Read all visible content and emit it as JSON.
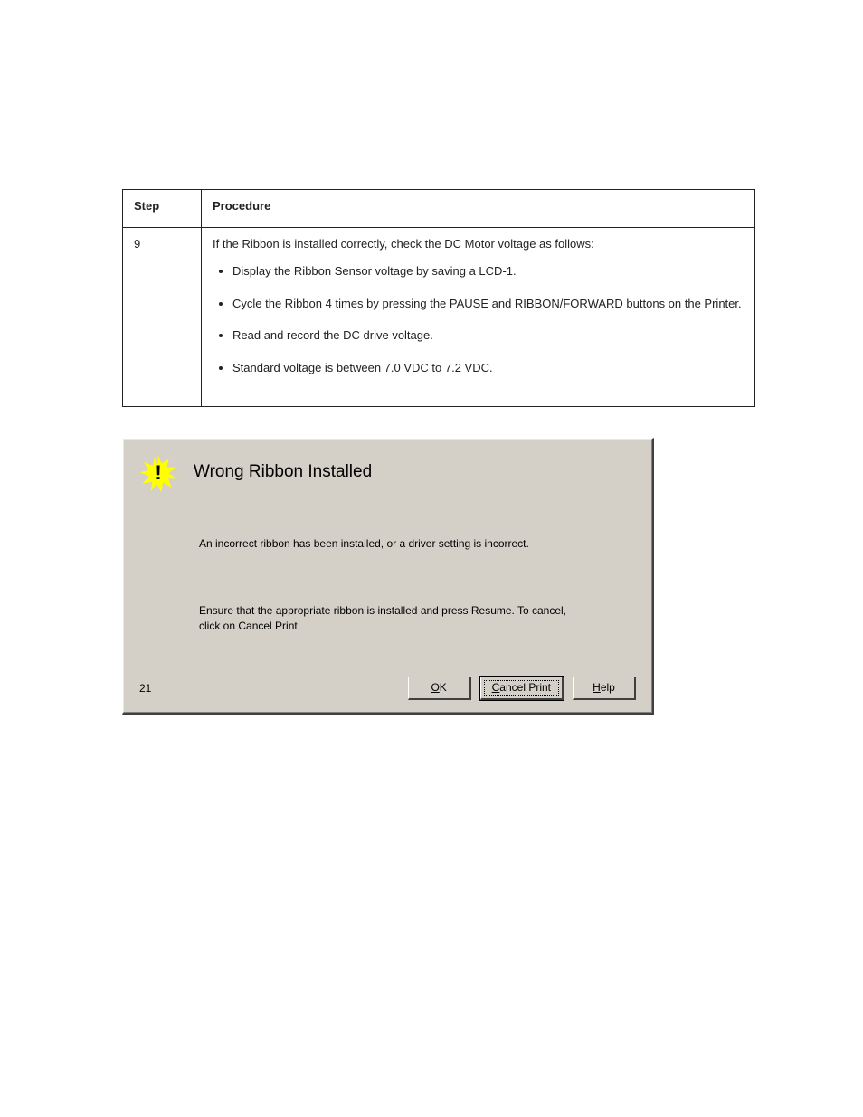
{
  "table": {
    "headers": {
      "step": "Step",
      "procedure": "Procedure"
    },
    "step_num": "9",
    "lead": "If the Ribbon is installed correctly, check the DC Motor voltage as follows:",
    "bullets": [
      "Display the Ribbon Sensor voltage by saving a LCD-1.",
      "Cycle the Ribbon 4 times by pressing the PAUSE and RIBBON/FORWARD buttons on the Printer.",
      "Read and record the DC drive voltage.",
      "Standard voltage is between 7.0 VDC to 7.2 VDC."
    ]
  },
  "dialog": {
    "title": "Wrong Ribbon Installed",
    "message1": "An incorrect ribbon has been installed, or a driver setting is incorrect.",
    "message2": "Ensure that the appropriate ribbon is installed and press Resume. To cancel, click on Cancel Print.",
    "error_code": "21",
    "buttons": {
      "ok_prefix": "O",
      "ok_rest": "K",
      "cancel_prefix": "C",
      "cancel_rest": "ancel Print",
      "help_prefix": "H",
      "help_rest": "elp"
    },
    "icon_glyph": "!"
  }
}
